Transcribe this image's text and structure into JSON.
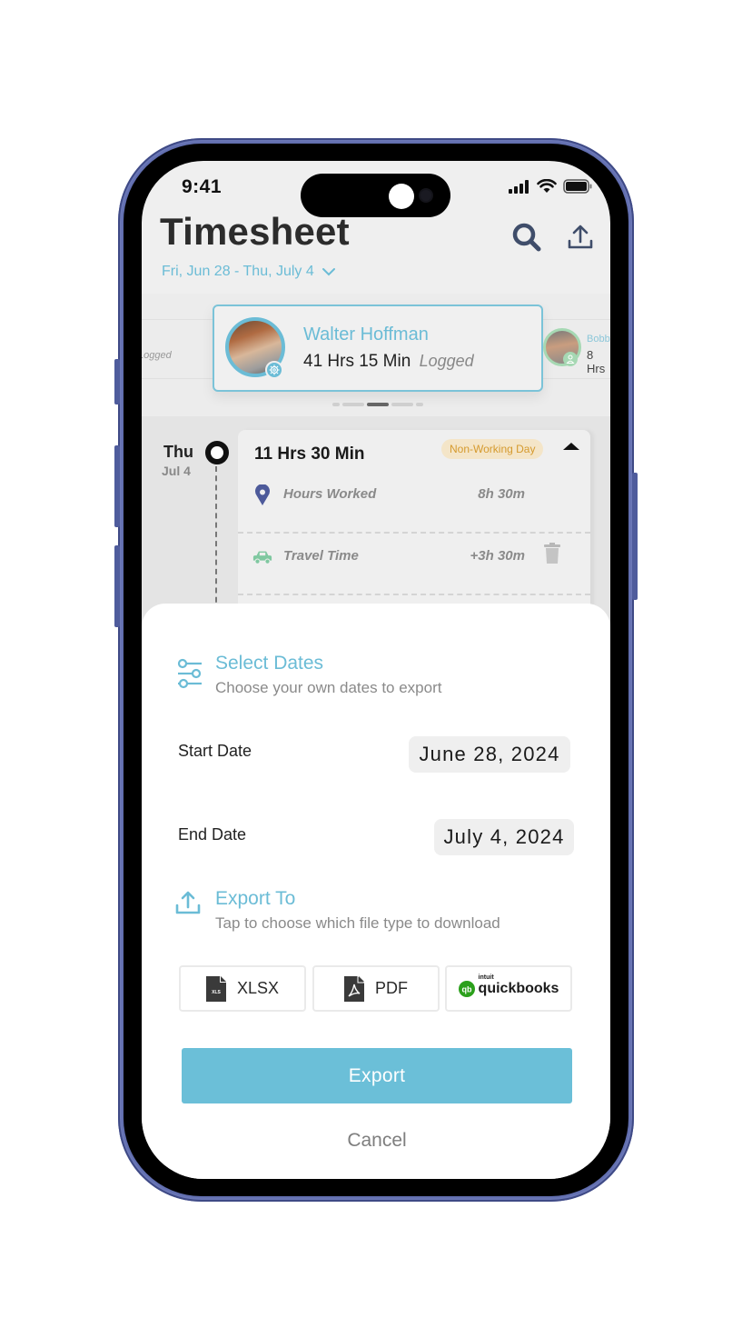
{
  "status_bar": {
    "time": "9:41"
  },
  "header": {
    "title": "Timesheet",
    "date_range": "Fri, Jun 28 - Thu, July 4",
    "search_icon": "search-icon",
    "export_icon": "upload-icon"
  },
  "employees": {
    "previous": {
      "status": "Logged"
    },
    "current": {
      "name": "Walter Hoffman",
      "hours": "41 Hrs 15 Min",
      "status": "Logged",
      "badge_icon": "gear-icon"
    },
    "next": {
      "name": "Bobby",
      "hours": "8 Hrs",
      "badge_icon": "user-icon"
    },
    "pager": {
      "count": 5,
      "active_index": 2
    }
  },
  "timeline": {
    "day": "Thu",
    "date": "Jul 4",
    "total": "11 Hrs 30 Min",
    "badge": "Non-Working Day",
    "entries": [
      {
        "icon": "map-pin-icon",
        "label": "Hours Worked",
        "value": "8h 30m",
        "deletable": false
      },
      {
        "icon": "car-icon",
        "label": "Travel Time",
        "value": "+3h 30m",
        "deletable": true
      }
    ]
  },
  "sheet": {
    "select_dates": {
      "title": "Select Dates",
      "subtitle": "Choose your own dates to export",
      "icon": "sliders-icon"
    },
    "start_date": {
      "label": "Start Date",
      "value": "June 28, 2024"
    },
    "end_date": {
      "label": "End Date",
      "value": "July 4, 2024"
    },
    "export_to": {
      "title": "Export To",
      "subtitle": "Tap to choose which file type to download",
      "icon": "upload-icon"
    },
    "file_types": [
      {
        "label": "XLSX",
        "icon": "xls-file-icon"
      },
      {
        "label": "PDF",
        "icon": "pdf-file-icon"
      },
      {
        "label": "quickbooks",
        "brand_prefix": "intuit",
        "icon": "quickbooks-logo-icon"
      }
    ],
    "export_button": "Export",
    "cancel_button": "Cancel"
  },
  "colors": {
    "accent": "#6bbcd6",
    "export_button": "#6bbfd8",
    "badge_bg": "#f4e5c8",
    "badge_text": "#d59a2e",
    "pin": "#4d5a9a",
    "car": "#7fc8a0",
    "quickbooks_green": "#2ca01c",
    "phone_frame": "#5a67a8"
  }
}
